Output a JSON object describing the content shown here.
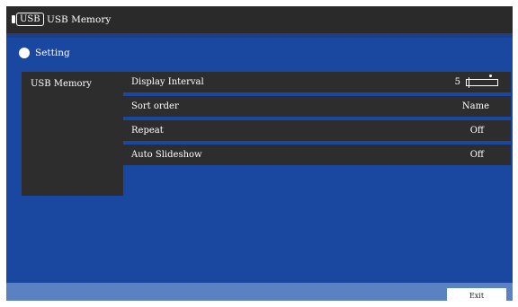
{
  "titlebar": {
    "badge": "USB",
    "title": "USB Memory"
  },
  "section": {
    "title": "Setting"
  },
  "categories": [
    {
      "label": "USB Memory"
    }
  ],
  "settings": {
    "display_interval": {
      "label": "Display Interval",
      "value": "5",
      "level": 0.0
    },
    "sort_order": {
      "label": "Sort order",
      "value": "Name"
    },
    "repeat": {
      "label": "Repeat",
      "value": "Off"
    },
    "auto_slideshow": {
      "label": "Auto Slideshow",
      "value": "Off"
    }
  },
  "footer": {
    "exit_label": "Exit"
  },
  "colors": {
    "background": "#1a47a0",
    "titlebar": "#2a2a2a",
    "panel": "#2d2d2d",
    "footer": "#5a82c2",
    "text": "#ffffff"
  }
}
